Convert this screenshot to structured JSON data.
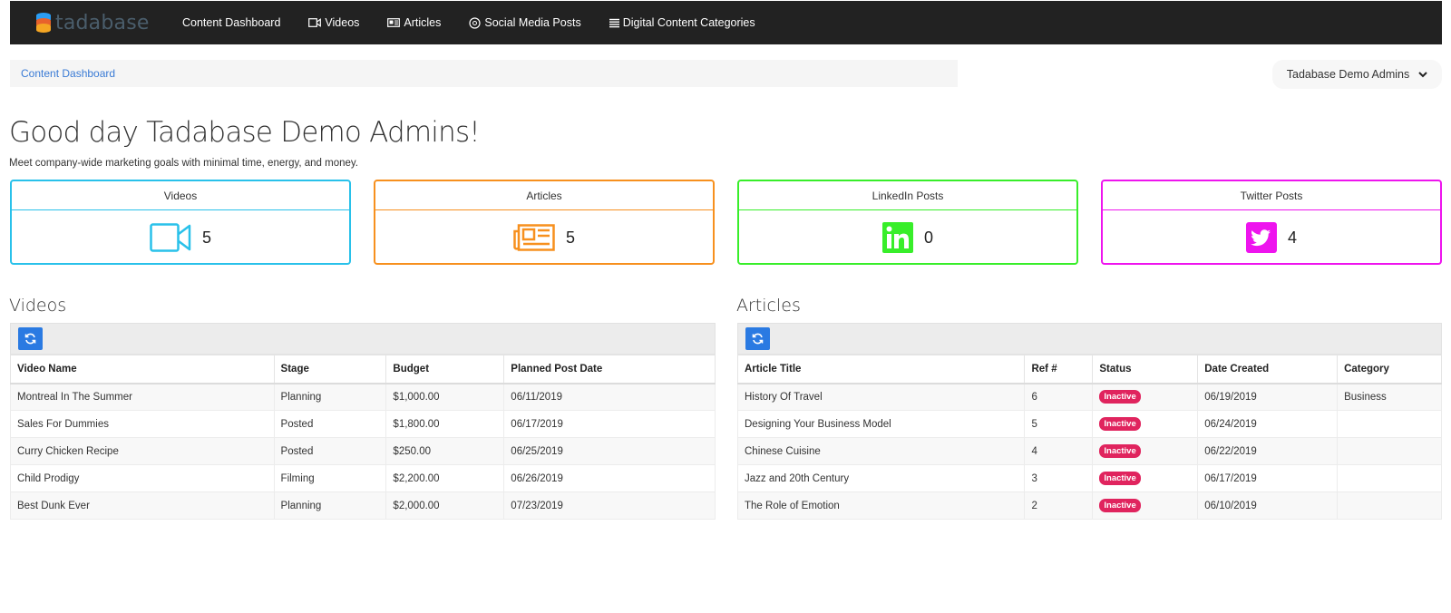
{
  "app": {
    "brand": "tadabase"
  },
  "nav": {
    "items": [
      {
        "label": "Content Dashboard",
        "icon": "none"
      },
      {
        "label": "Videos",
        "icon": "video-icon"
      },
      {
        "label": "Articles",
        "icon": "newspaper-icon"
      },
      {
        "label": "Social Media Posts",
        "icon": "social-icon"
      },
      {
        "label": "Digital Content Categories",
        "icon": "list-icon"
      }
    ]
  },
  "breadcrumb": {
    "current": "Content Dashboard"
  },
  "user_menu": {
    "label": "Tadabase Demo Admins"
  },
  "greeting": "Good day Tadabase Demo Admins!",
  "subtitle": "Meet company-wide marketing goals with minimal time, energy, and money.",
  "cards": [
    {
      "title": "Videos",
      "value": "5",
      "color": "#29c1ea",
      "icon": "video-icon"
    },
    {
      "title": "Articles",
      "value": "5",
      "color": "#f7901e",
      "icon": "newspaper-icon"
    },
    {
      "title": "LinkedIn Posts",
      "value": "0",
      "color": "#38ee2a",
      "icon": "linkedin-icon"
    },
    {
      "title": "Twitter Posts",
      "value": "4",
      "color": "#ee14ee",
      "icon": "twitter-icon"
    }
  ],
  "videos": {
    "title": "Videos",
    "columns": [
      "Video Name",
      "Stage",
      "Budget",
      "Planned Post Date"
    ],
    "rows": [
      [
        "Montreal In The Summer",
        "Planning",
        "$1,000.00",
        "06/11/2019"
      ],
      [
        "Sales For Dummies",
        "Posted",
        "$1,800.00",
        "06/17/2019"
      ],
      [
        "Curry Chicken Recipe",
        "Posted",
        "$250.00",
        "06/25/2019"
      ],
      [
        "Child Prodigy",
        "Filming",
        "$2,200.00",
        "06/26/2019"
      ],
      [
        "Best Dunk Ever",
        "Planning",
        "$2,000.00",
        "07/23/2019"
      ]
    ]
  },
  "articles": {
    "title": "Articles",
    "columns": [
      "Article Title",
      "Ref #",
      "Status",
      "Date Created",
      "Category"
    ],
    "rows": [
      [
        "History Of Travel",
        "6",
        "Inactive",
        "06/19/2019",
        "Business"
      ],
      [
        "Designing Your Business Model",
        "5",
        "Inactive",
        "06/24/2019",
        ""
      ],
      [
        "Chinese Cuisine",
        "4",
        "Inactive",
        "06/22/2019",
        ""
      ],
      [
        "Jazz and 20th Century",
        "3",
        "Inactive",
        "06/17/2019",
        ""
      ],
      [
        "The Role of Emotion",
        "2",
        "Inactive",
        "06/10/2019",
        ""
      ]
    ]
  }
}
